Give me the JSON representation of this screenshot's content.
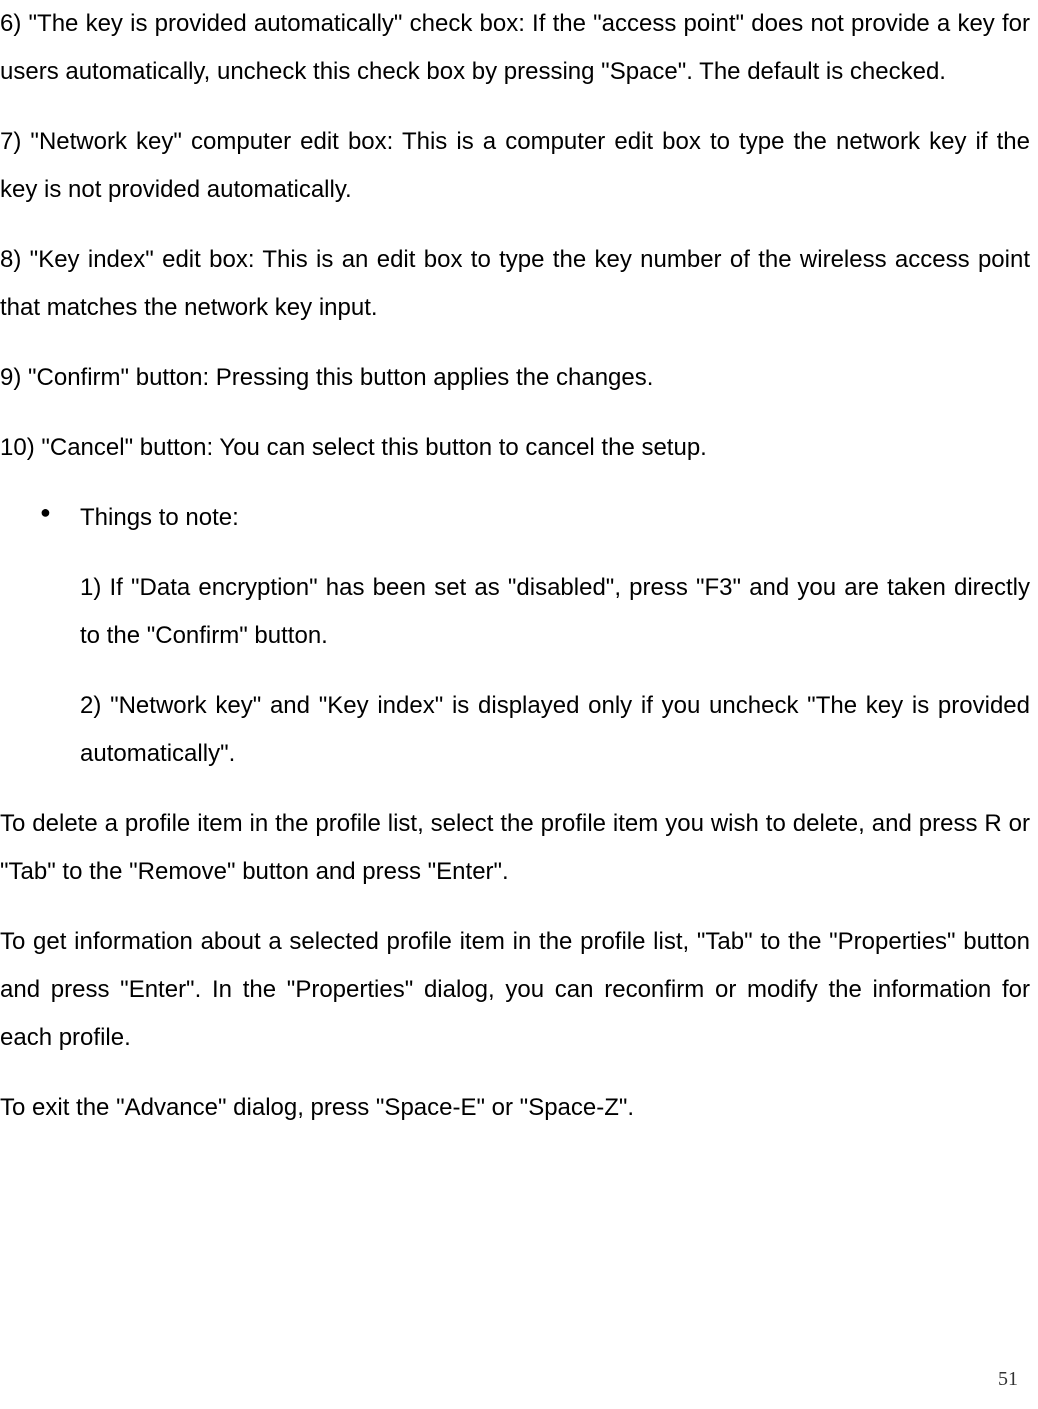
{
  "paragraphs": {
    "p6": "6) \"The key is provided automatically\" check box: If the \"access point\" does not provide a key for users automatically, uncheck this check box by pressing \"Space\". The default is checked.",
    "p7": "7) \"Network key\" computer edit box: This is a computer edit box to type the network key if the key is not provided automatically.",
    "p8": "8) \"Key index\" edit box: This is an edit box to type the key number of the wireless access point that matches the network key input.",
    "p9": "9) \"Confirm\" button: Pressing this button applies the changes.",
    "p10": "10) \"Cancel\" button: You can select this button to cancel the setup.",
    "bullet": "Things to note:",
    "sub1": "1) If \"Data encryption\" has been set as \"disabled\", press \"F3\" and you are taken directly to the \"Confirm\" button.",
    "sub2": "2) \"Network key\" and \"Key index\" is displayed only if you uncheck \"The key is provided automatically\".",
    "delete": "To delete a profile item in the profile list, select the profile item you wish to delete, and press R or \"Tab\" to the \"Remove\" button and press \"Enter\".",
    "info": "To get information about a selected profile item in the profile list, \"Tab\" to the \"Properties\" button and press \"Enter\". In the \"Properties\" dialog, you can reconfirm or modify the information for each profile.",
    "exit": "To exit the \"Advance\" dialog, press \"Space-E\" or \"Space-Z\"."
  },
  "page_number": "51"
}
